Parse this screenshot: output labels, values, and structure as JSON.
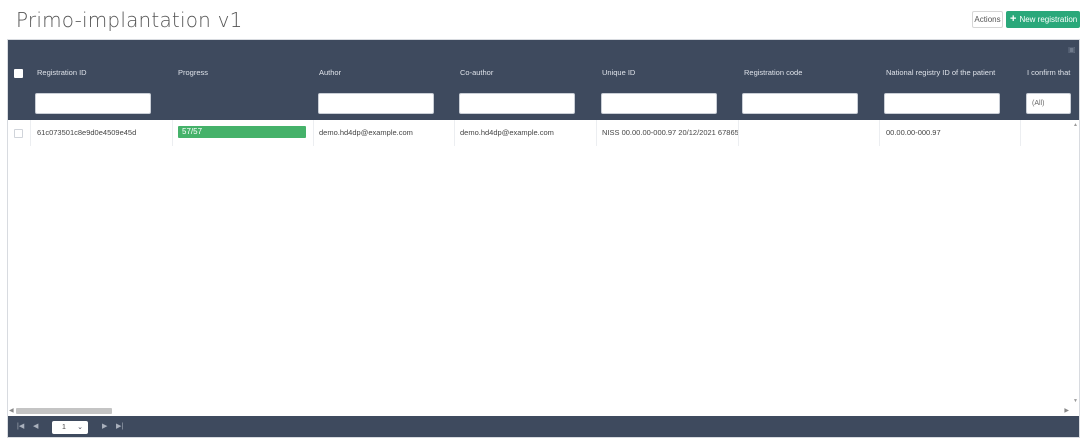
{
  "header": {
    "title": "Primo-implantation v1",
    "actions_label": "Actions",
    "new_registration_label": "New registration"
  },
  "grid": {
    "columns": [
      "Registration ID",
      "Progress",
      "Author",
      "Co-author",
      "Unique ID",
      "Registration code",
      "National registry ID of the patient",
      "I confirm that"
    ],
    "confirm_filter_value": "(All)",
    "rows": [
      {
        "registration_id": "61c073501c8e9d0e4509e45d",
        "progress": "57/57",
        "progress_fraction": 1.0,
        "author": "demo.hd4dp@example.com",
        "co_author": "demo.hd4dp@example.com",
        "unique_id": "NISS 00.00.00-000.97 20/12/2021 67865",
        "registration_code": "",
        "national_registry_id": "00.00.00-000.97"
      }
    ]
  },
  "pager": {
    "current_page": "1"
  },
  "colors": {
    "header_bg": "#3e4a5e",
    "accent_green": "#2aa87a",
    "progress_green": "#45b26a"
  }
}
